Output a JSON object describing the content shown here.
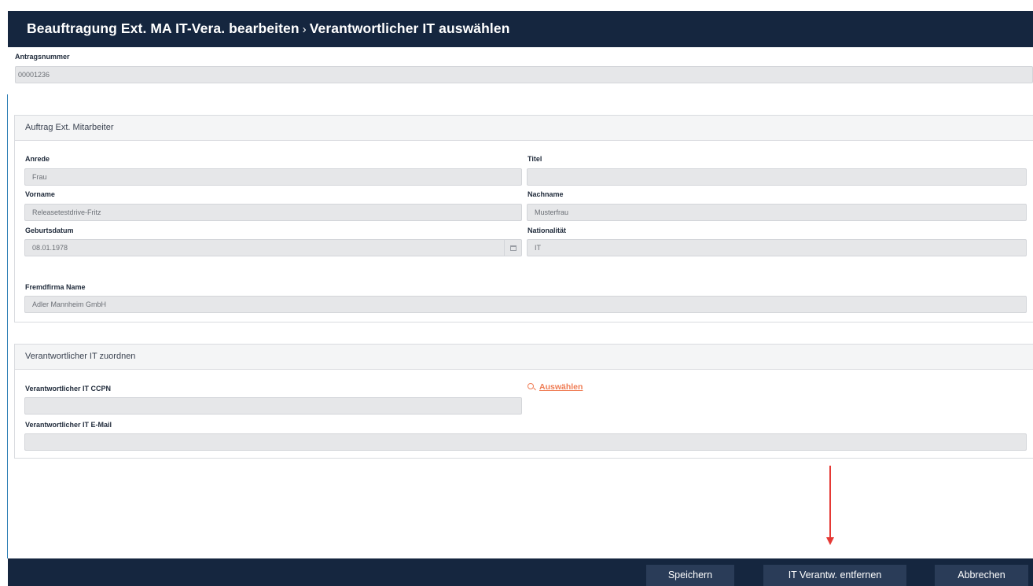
{
  "header": {
    "title": "Beauftragung Ext. MA IT-Vera. bearbeiten",
    "separator": "›",
    "subtitle": "Verantwortlicher IT auswählen"
  },
  "antrag": {
    "label": "Antragsnummer",
    "value": "00001236"
  },
  "section_mitarbeiter": {
    "title": "Auftrag Ext. Mitarbeiter",
    "anrede": {
      "label": "Anrede",
      "value": "Frau"
    },
    "titel": {
      "label": "Titel",
      "value": ""
    },
    "vorname": {
      "label": "Vorname",
      "value": "Releasetestdrive-Fritz"
    },
    "nachname": {
      "label": "Nachname",
      "value": "Musterfrau"
    },
    "geburtsdatum": {
      "label": "Geburtsdatum",
      "value": "08.01.1978"
    },
    "nationalitaet": {
      "label": "Nationalität",
      "value": "IT"
    },
    "fremdfirma": {
      "label": "Fremdfirma Name",
      "value": "Adler Mannheim GmbH"
    }
  },
  "section_it": {
    "title": "Verantwortlicher IT zuordnen",
    "ccpn": {
      "label": "Verantwortlicher IT CCPN",
      "value": ""
    },
    "select_link": "Auswählen",
    "email": {
      "label": "Verantwortlicher IT E-Mail",
      "value": ""
    }
  },
  "footer": {
    "save_label": "Speichern",
    "remove_label": "IT Verantw. entfernen",
    "cancel_label": "Abbrechen"
  },
  "icons": {
    "search": "search-icon",
    "calendar": "calendar-icon",
    "annotation_arrow": "red-arrow-down"
  },
  "colors": {
    "header_bg": "#15263f",
    "button_bg": "#2a3c58",
    "link": "#ef7c54",
    "annotation": "#e53935"
  }
}
